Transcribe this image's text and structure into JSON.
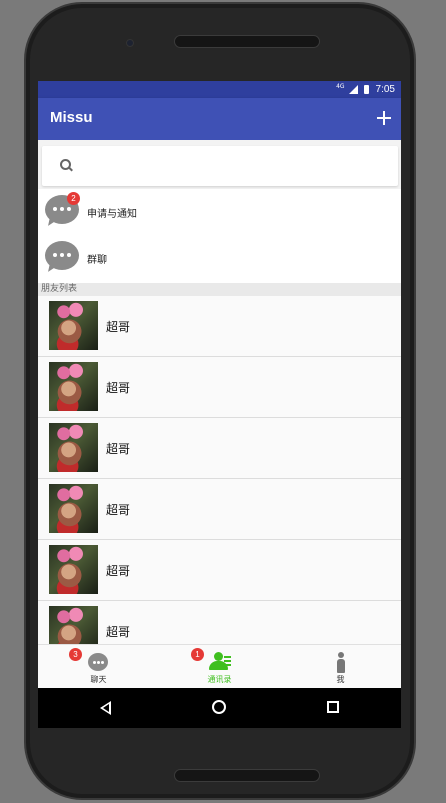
{
  "status_bar": {
    "network": "4G",
    "time": "7:05"
  },
  "app_bar": {
    "title": "Missu",
    "add_icon": "plus-icon"
  },
  "search": {
    "placeholder": "",
    "value": "",
    "icon": "search-icon"
  },
  "functions": [
    {
      "label": "申请与通知",
      "badge": "2",
      "icon": "chat-bubble-icon"
    },
    {
      "label": "群聊",
      "badge": "",
      "icon": "chat-bubble-icon"
    }
  ],
  "friends_section": {
    "title": "朋友列表"
  },
  "friends": [
    {
      "name": "超哥"
    },
    {
      "name": "超哥"
    },
    {
      "name": "超哥"
    },
    {
      "name": "超哥"
    },
    {
      "name": "超哥"
    },
    {
      "name": "超哥"
    }
  ],
  "bottom_nav": {
    "items": [
      {
        "label": "聊天",
        "badge": "3",
        "icon": "chat-bubble-icon",
        "active": false
      },
      {
        "label": "通讯录",
        "badge": "1",
        "icon": "contacts-icon",
        "active": true
      },
      {
        "label": "我",
        "badge": "",
        "icon": "person-icon",
        "active": false
      }
    ]
  },
  "colors": {
    "primary": "#3f51b5",
    "status_bar": "#2f3f9e",
    "active_tab": "#3fbf1f",
    "badge": "#e53935"
  }
}
